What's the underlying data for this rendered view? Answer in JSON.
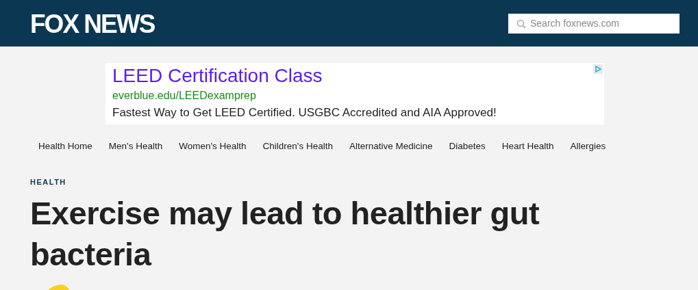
{
  "header": {
    "logo": "FOX NEWS",
    "search": {
      "placeholder": "Search foxnews.com"
    }
  },
  "ad": {
    "title": "LEED Certification Class",
    "url": "everblue.edu/LEEDexamprep",
    "text": "Fastest Way to Get LEED Certified. USGBC Accredited and AIA Approved!"
  },
  "nav": [
    {
      "label": "Health Home"
    },
    {
      "label": "Men's Health"
    },
    {
      "label": "Women's Health"
    },
    {
      "label": "Children's Health"
    },
    {
      "label": "Alternative Medicine"
    },
    {
      "label": "Diabetes"
    },
    {
      "label": "Heart Health"
    },
    {
      "label": "Allergies"
    }
  ],
  "article": {
    "category": "HEALTH",
    "headline": "Exercise may lead to healthier gut bacteria"
  }
}
